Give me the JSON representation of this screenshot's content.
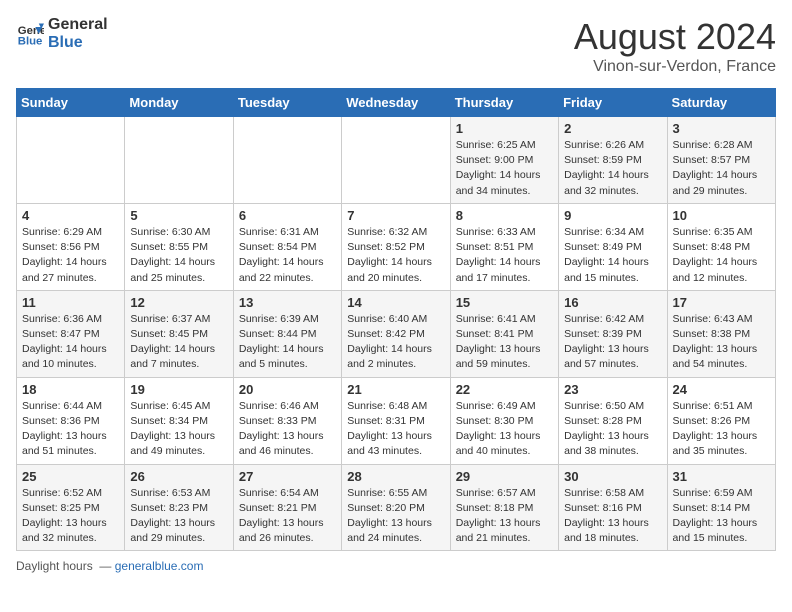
{
  "logo": {
    "line1": "General",
    "line2": "Blue"
  },
  "title": "August 2024",
  "subtitle": "Vinon-sur-Verdon, France",
  "weekdays": [
    "Sunday",
    "Monday",
    "Tuesday",
    "Wednesday",
    "Thursday",
    "Friday",
    "Saturday"
  ],
  "weeks": [
    [
      {
        "day": "",
        "info": ""
      },
      {
        "day": "",
        "info": ""
      },
      {
        "day": "",
        "info": ""
      },
      {
        "day": "",
        "info": ""
      },
      {
        "day": "1",
        "info": "Sunrise: 6:25 AM\nSunset: 9:00 PM\nDaylight: 14 hours and 34 minutes."
      },
      {
        "day": "2",
        "info": "Sunrise: 6:26 AM\nSunset: 8:59 PM\nDaylight: 14 hours and 32 minutes."
      },
      {
        "day": "3",
        "info": "Sunrise: 6:28 AM\nSunset: 8:57 PM\nDaylight: 14 hours and 29 minutes."
      }
    ],
    [
      {
        "day": "4",
        "info": "Sunrise: 6:29 AM\nSunset: 8:56 PM\nDaylight: 14 hours and 27 minutes."
      },
      {
        "day": "5",
        "info": "Sunrise: 6:30 AM\nSunset: 8:55 PM\nDaylight: 14 hours and 25 minutes."
      },
      {
        "day": "6",
        "info": "Sunrise: 6:31 AM\nSunset: 8:54 PM\nDaylight: 14 hours and 22 minutes."
      },
      {
        "day": "7",
        "info": "Sunrise: 6:32 AM\nSunset: 8:52 PM\nDaylight: 14 hours and 20 minutes."
      },
      {
        "day": "8",
        "info": "Sunrise: 6:33 AM\nSunset: 8:51 PM\nDaylight: 14 hours and 17 minutes."
      },
      {
        "day": "9",
        "info": "Sunrise: 6:34 AM\nSunset: 8:49 PM\nDaylight: 14 hours and 15 minutes."
      },
      {
        "day": "10",
        "info": "Sunrise: 6:35 AM\nSunset: 8:48 PM\nDaylight: 14 hours and 12 minutes."
      }
    ],
    [
      {
        "day": "11",
        "info": "Sunrise: 6:36 AM\nSunset: 8:47 PM\nDaylight: 14 hours and 10 minutes."
      },
      {
        "day": "12",
        "info": "Sunrise: 6:37 AM\nSunset: 8:45 PM\nDaylight: 14 hours and 7 minutes."
      },
      {
        "day": "13",
        "info": "Sunrise: 6:39 AM\nSunset: 8:44 PM\nDaylight: 14 hours and 5 minutes."
      },
      {
        "day": "14",
        "info": "Sunrise: 6:40 AM\nSunset: 8:42 PM\nDaylight: 14 hours and 2 minutes."
      },
      {
        "day": "15",
        "info": "Sunrise: 6:41 AM\nSunset: 8:41 PM\nDaylight: 13 hours and 59 minutes."
      },
      {
        "day": "16",
        "info": "Sunrise: 6:42 AM\nSunset: 8:39 PM\nDaylight: 13 hours and 57 minutes."
      },
      {
        "day": "17",
        "info": "Sunrise: 6:43 AM\nSunset: 8:38 PM\nDaylight: 13 hours and 54 minutes."
      }
    ],
    [
      {
        "day": "18",
        "info": "Sunrise: 6:44 AM\nSunset: 8:36 PM\nDaylight: 13 hours and 51 minutes."
      },
      {
        "day": "19",
        "info": "Sunrise: 6:45 AM\nSunset: 8:34 PM\nDaylight: 13 hours and 49 minutes."
      },
      {
        "day": "20",
        "info": "Sunrise: 6:46 AM\nSunset: 8:33 PM\nDaylight: 13 hours and 46 minutes."
      },
      {
        "day": "21",
        "info": "Sunrise: 6:48 AM\nSunset: 8:31 PM\nDaylight: 13 hours and 43 minutes."
      },
      {
        "day": "22",
        "info": "Sunrise: 6:49 AM\nSunset: 8:30 PM\nDaylight: 13 hours and 40 minutes."
      },
      {
        "day": "23",
        "info": "Sunrise: 6:50 AM\nSunset: 8:28 PM\nDaylight: 13 hours and 38 minutes."
      },
      {
        "day": "24",
        "info": "Sunrise: 6:51 AM\nSunset: 8:26 PM\nDaylight: 13 hours and 35 minutes."
      }
    ],
    [
      {
        "day": "25",
        "info": "Sunrise: 6:52 AM\nSunset: 8:25 PM\nDaylight: 13 hours and 32 minutes."
      },
      {
        "day": "26",
        "info": "Sunrise: 6:53 AM\nSunset: 8:23 PM\nDaylight: 13 hours and 29 minutes."
      },
      {
        "day": "27",
        "info": "Sunrise: 6:54 AM\nSunset: 8:21 PM\nDaylight: 13 hours and 26 minutes."
      },
      {
        "day": "28",
        "info": "Sunrise: 6:55 AM\nSunset: 8:20 PM\nDaylight: 13 hours and 24 minutes."
      },
      {
        "day": "29",
        "info": "Sunrise: 6:57 AM\nSunset: 8:18 PM\nDaylight: 13 hours and 21 minutes."
      },
      {
        "day": "30",
        "info": "Sunrise: 6:58 AM\nSunset: 8:16 PM\nDaylight: 13 hours and 18 minutes."
      },
      {
        "day": "31",
        "info": "Sunrise: 6:59 AM\nSunset: 8:14 PM\nDaylight: 13 hours and 15 minutes."
      }
    ]
  ],
  "footer": "Daylight hours"
}
